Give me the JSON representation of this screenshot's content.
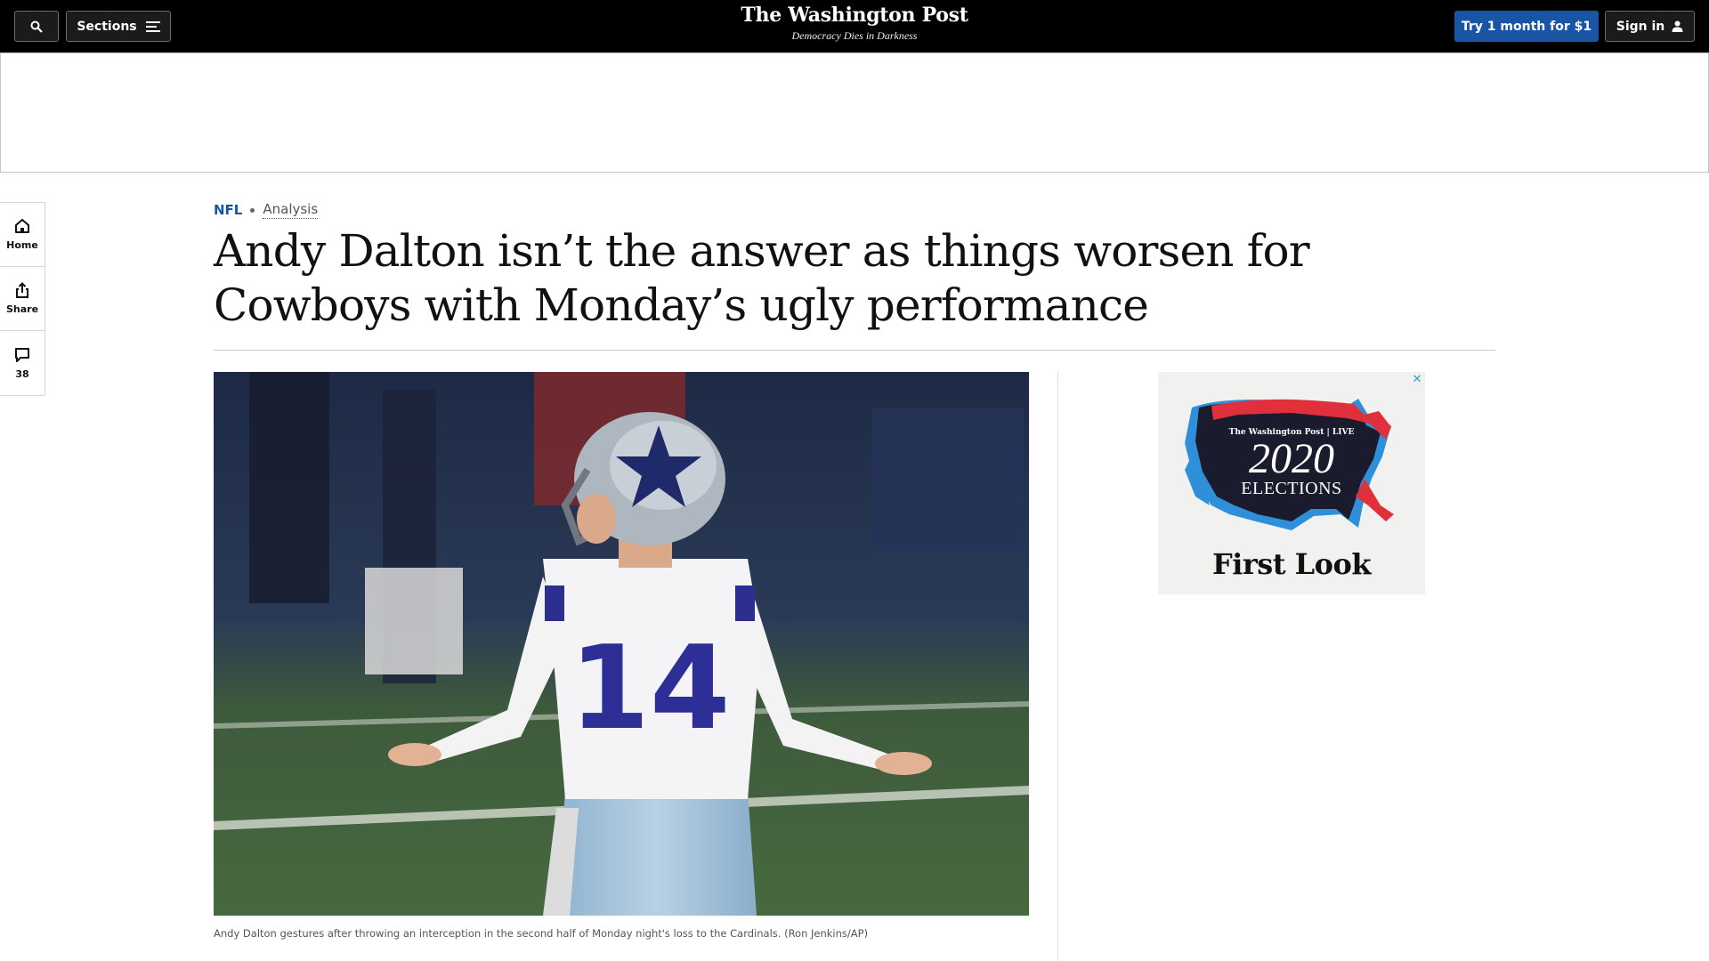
{
  "header": {
    "sections_label": "Sections",
    "logo": "The Washington Post",
    "tagline": "Democracy Dies in Darkness",
    "subscribe_label": "Try 1 month for $1",
    "signin_label": "Sign in"
  },
  "rail": {
    "home_label": "Home",
    "share_label": "Share",
    "comments_count": "38"
  },
  "article": {
    "kicker_section": "NFL",
    "kicker_label": "Analysis",
    "headline": "Andy Dalton isn’t the answer as things worsen for Cowboys with Monday’s ugly performance",
    "jersey_number": "14",
    "caption": "Andy Dalton gestures after throwing an interception in the second half of Monday night's loss to the Cardinals. (Ron Jenkins/AP)"
  },
  "ad": {
    "close": "✕",
    "brand": "The Washington Post | LIVE",
    "year": "2020",
    "elections": "ELECTIONS",
    "first_look": "First Look"
  },
  "colors": {
    "accent_blue": "#1955a5",
    "topbar_bg": "#000000",
    "ad_map_dark": "#1b1b2e",
    "ad_red": "#e0303b",
    "ad_blue": "#2f8fd9"
  },
  "icons": [
    "search-icon",
    "menu-icon",
    "user-icon",
    "home-icon",
    "share-icon",
    "comment-icon"
  ]
}
